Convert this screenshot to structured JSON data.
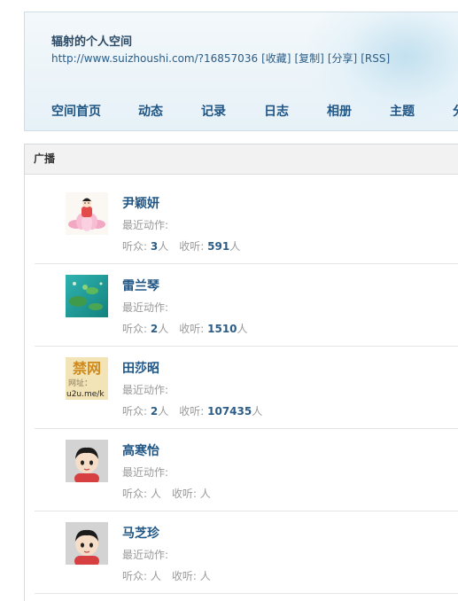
{
  "header": {
    "title": "辐射的个人空间",
    "url": "http://www.suizhoushi.com/?16857036",
    "actions": [
      "[收藏]",
      "[复制]",
      "[分享]",
      "[RSS]"
    ]
  },
  "nav": {
    "items": [
      "空间首页",
      "动态",
      "记录",
      "日志",
      "相册",
      "主题",
      "分"
    ]
  },
  "broadcast": {
    "title": "广播",
    "users": [
      {
        "name": "尹颖妍",
        "avatar": "lotus-avatar",
        "recent_label": "最近动作:",
        "listeners_label": "听众:",
        "listeners": "3",
        "listening_label": "收听:",
        "listening": "591",
        "unit": "人"
      },
      {
        "name": "雷兰琴",
        "avatar": "frog-pond-avatar",
        "recent_label": "最近动作:",
        "listeners_label": "听众:",
        "listeners": "2",
        "listening_label": "收听:",
        "listening": "1510",
        "unit": "人"
      },
      {
        "name": "田莎昭",
        "avatar": "banned-site-avatar",
        "avatar_text": [
          "禁网",
          "网址：",
          "u2u.me/k"
        ],
        "recent_label": "最近动作:",
        "listeners_label": "听众:",
        "listeners": "2",
        "listening_label": "收听:",
        "listening": "107435",
        "unit": "人"
      },
      {
        "name": "高寒怡",
        "avatar": "default-cartoon-avatar",
        "recent_label": "最近动作:",
        "listeners_label": "听众:",
        "listeners": "",
        "listening_label": "收听:",
        "listening": "",
        "unit": "人"
      },
      {
        "name": "马芝珍",
        "avatar": "default-cartoon-avatar",
        "recent_label": "最近动作:",
        "listeners_label": "听众:",
        "listeners": "",
        "listening_label": "收听:",
        "listening": "",
        "unit": "人"
      }
    ]
  }
}
